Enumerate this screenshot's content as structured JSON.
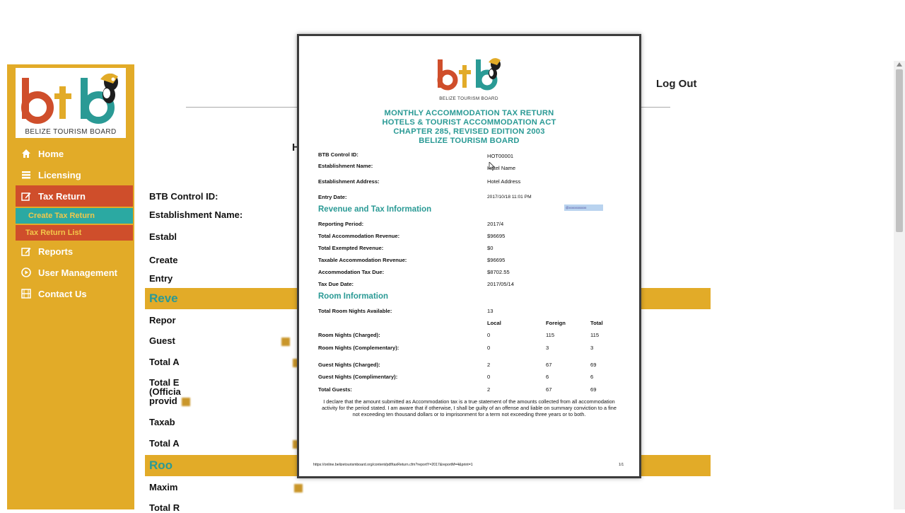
{
  "brand": {
    "logo_text": "btb",
    "logo_subtitle": "BELIZE TOURISM BOARD",
    "colors": {
      "orange": "#cf4e2b",
      "gold": "#e2ab28",
      "teal": "#2a9a95"
    }
  },
  "sidebar": {
    "items": [
      {
        "label": "Home",
        "icon": "home-icon"
      },
      {
        "label": "Licensing",
        "icon": "list-icon"
      },
      {
        "label": "Tax Return",
        "icon": "edit-icon",
        "active": true
      },
      {
        "label": "Reports",
        "icon": "edit-icon"
      },
      {
        "label": "User Management",
        "icon": "play-circle-icon"
      },
      {
        "label": "Contact Us",
        "icon": "film-icon"
      }
    ],
    "subitems": [
      {
        "label": "Create Tax Return"
      },
      {
        "label": "Tax Return List"
      }
    ]
  },
  "header": {
    "logout_label": "Log Out"
  },
  "form": {
    "btb_control_id_label": "BTB Control ID:",
    "establishment_name_label": "Establishment Name:",
    "establishment_address_label": "Establ",
    "created_by_label": "Create",
    "entry_date_label": "Entry",
    "revenue_section": "Reve",
    "reporting_label": "Repor",
    "guest_label": "Guest",
    "total_a_label": "Total A",
    "total_e_label": "Total E",
    "official_label": "(Officia",
    "provided_label": "provid",
    "taxable_label": "Taxab",
    "total_a2_label": "Total A",
    "room_section": "Roo",
    "maximum_label": "Maxim",
    "total_r_label": "Total R",
    "heading_frag_1": "H"
  },
  "pdf": {
    "title_lines": [
      "MONTHLY ACCOMMODATION TAX RETURN",
      "HOTELS & TOURIST ACCOMMODATION ACT",
      "CHAPTER 285, REVISED EDITION 2003",
      "BELIZE TOURISM BOARD"
    ],
    "fields": [
      {
        "label": "BTB Control ID:",
        "value": "HOT00001"
      },
      {
        "label": "Establishment Name:",
        "value": "Hotel Name"
      },
      {
        "label": "Establishment Address:",
        "value": "Hotel Address"
      },
      {
        "label": "Entry Date:",
        "value": "2017/10/18 11:01 PM"
      }
    ],
    "revenue_title": "Revenue and Tax Information",
    "revenue_rows": [
      {
        "label": "Reporting Period:",
        "value": "2017/4"
      },
      {
        "label": "Total Accommodation Revenue:",
        "value": "$96695"
      },
      {
        "label": "Total Exempted Revenue:",
        "value": "$0"
      },
      {
        "label": "Taxable Accommodation Revenue:",
        "value": "$96695"
      },
      {
        "label": "Accommodation Tax Due:",
        "value": "$8702.55"
      },
      {
        "label": "Tax Due Date:",
        "value": "2017/05/14"
      }
    ],
    "room_title": "Room Information",
    "room_nights_available_label": "Total Room Nights Available:",
    "room_nights_available_value": "13",
    "room_columns": [
      "Local",
      "Foreign",
      "Total"
    ],
    "room_rows": [
      {
        "label": "Room Nights (Charged):",
        "local": "0",
        "foreign": "115",
        "total": "115"
      },
      {
        "label": "Room Nights (Complementary):",
        "local": "0",
        "foreign": "3",
        "total": "3"
      },
      {
        "label": "Guest Nights (Charged):",
        "local": "2",
        "foreign": "67",
        "total": "69"
      },
      {
        "label": "Guest Nights (Complimentary):",
        "local": "0",
        "foreign": "6",
        "total": "6"
      },
      {
        "label": "Total Guests:",
        "local": "2",
        "foreign": "67",
        "total": "69"
      }
    ],
    "declaration": "I declare that the amount submitted as Accommodation tax is a true statement of the amounts collected from all accommodation activity for the period stated. I am aware that if otherwise, I shall be guilty of an offense and liable on summary conviction to a fine not exceeding ten thousand dollars or to imprisonment for a term not exceeding three years or to both.",
    "footer_url": "https://online.belizetourismboard.org/content/pdf/taxReturn.cfm?reportY=2017&reportM=4&print=1",
    "page_number": "1/1",
    "selection_text": "@xxxxxxxxxxxx"
  }
}
